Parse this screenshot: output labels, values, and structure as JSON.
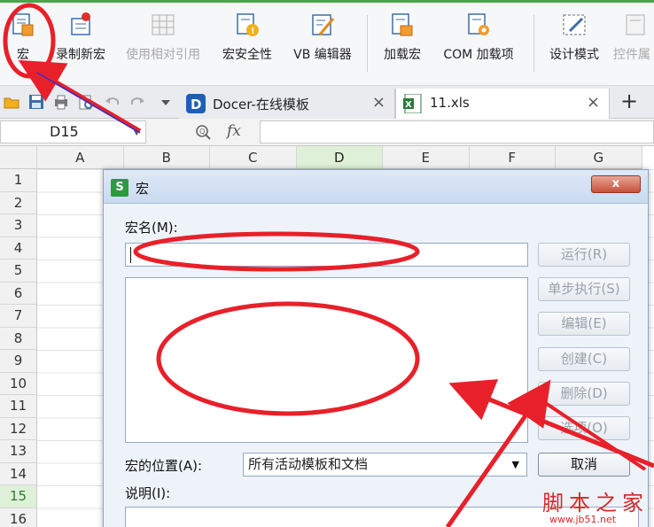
{
  "ribbon": {
    "macro": "宏",
    "record_macro": "录制新宏",
    "relative_ref": "使用相对引用",
    "macro_security": "宏安全性",
    "vb_editor": "VB 编辑器",
    "load_macro": "加载宏",
    "com_addins": "COM 加载项",
    "design_mode": "设计模式",
    "control_props": "控件属"
  },
  "tabs": [
    {
      "label": "Docer-在线模板",
      "close": "×"
    },
    {
      "label": "11.xls",
      "close": "×"
    }
  ],
  "new_tab": "+",
  "formula_bar": {
    "name_box": "D15",
    "fx": "fx"
  },
  "columns": [
    "A",
    "B",
    "C",
    "D",
    "E",
    "F",
    "G"
  ],
  "rows": [
    "1",
    "2",
    "3",
    "4",
    "5",
    "6",
    "7",
    "8",
    "9",
    "10",
    "11",
    "12",
    "13",
    "14",
    "15",
    "16"
  ],
  "selected_cell": {
    "column": "D",
    "row": "15"
  },
  "dialog": {
    "title": "宏",
    "logo": "S",
    "close": "x",
    "macro_name_label": "宏名(M):",
    "macro_name_value": "",
    "buttons": [
      {
        "label": "运行(R)",
        "enabled": false
      },
      {
        "label": "单步执行(S)",
        "enabled": false
      },
      {
        "label": "编辑(E)",
        "enabled": false
      },
      {
        "label": "创建(C)",
        "enabled": false
      },
      {
        "label": "删除(D)",
        "enabled": false
      },
      {
        "label": "选项(O)",
        "enabled": false
      }
    ],
    "cancel_label": "取消",
    "location_label": "宏的位置(A):",
    "location_value": "所有活动模板和文档",
    "description_label": "说明(I):"
  },
  "watermark": {
    "text": "脚本之家",
    "url": "www.jb51.net"
  },
  "colors": {
    "accent_green": "#4aa54a",
    "annotation_red": "#e8202a",
    "selected_header": "#dff0d8"
  }
}
